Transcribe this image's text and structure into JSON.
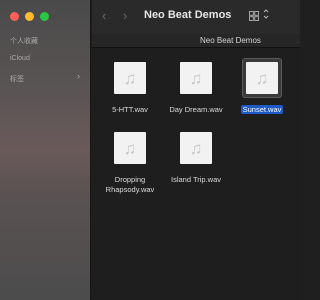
{
  "sidebar": {
    "items": [
      {
        "label": "个人收藏"
      },
      {
        "label": "iCloud"
      },
      {
        "label": "标签"
      }
    ]
  },
  "toolbar": {
    "title": "Neo Beat Demos",
    "back": "‹",
    "forward": "›",
    "view_chevron": "⌃⌄"
  },
  "pathbar": {
    "label": "Neo Beat Demos"
  },
  "files": [
    {
      "name": "5-HTT.wav",
      "selected": false
    },
    {
      "name": "Day Dream.wav",
      "selected": false
    },
    {
      "name": "Sunset.wav",
      "selected": true
    },
    {
      "name": "Dropping Rhapsody.wav",
      "selected": false
    },
    {
      "name": "Island Trip.wav",
      "selected": false
    }
  ],
  "icons": {
    "file_icon": "music-note-icon",
    "accent": "#1d5ac8"
  }
}
